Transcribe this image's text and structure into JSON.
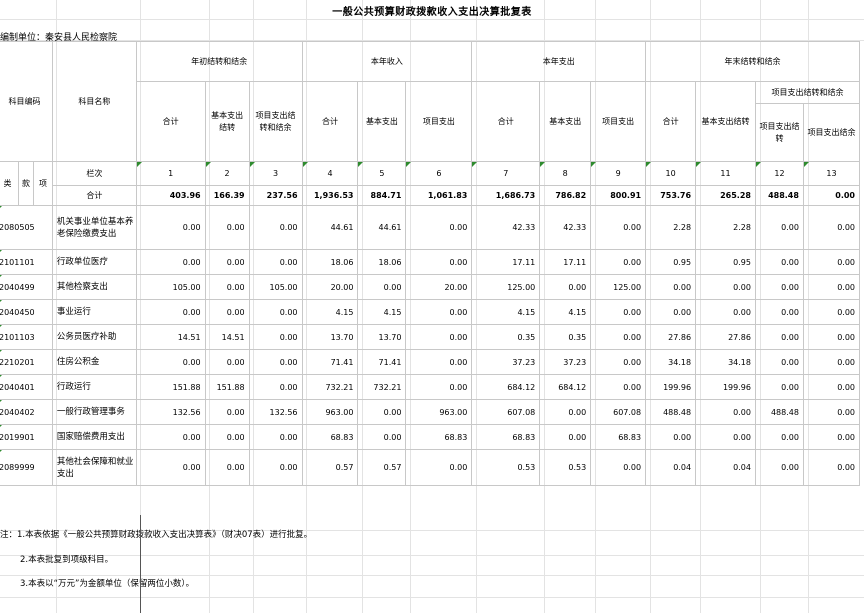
{
  "title": "一般公共预算财政拨款收入支出决算批复表",
  "unit_label": "编制单位：秦安县人民检察院",
  "headers": {
    "code": "科目编码",
    "name": "科目名称",
    "g1": "年初结转和结余",
    "g2": "本年收入",
    "g3": "本年支出",
    "g4": "年末结转和结余",
    "g4sub": "项目支出结转和结余",
    "total": "合计",
    "basic_carry": "基本支出结转",
    "proj_carry": "项目支出结转和结余",
    "basic": "基本支出",
    "proj": "项目支出",
    "proj_c": "项目支出结转",
    "proj_b": "项目支出结余",
    "lei": "类",
    "kuan": "款",
    "xiang": "项",
    "row_index_label": "栏次",
    "sum_label": "合计"
  },
  "col_indexes": [
    "1",
    "2",
    "3",
    "4",
    "5",
    "6",
    "7",
    "8",
    "9",
    "10",
    "11",
    "12",
    "13"
  ],
  "totals": [
    "403.96",
    "166.39",
    "237.56",
    "1,936.53",
    "884.71",
    "1,061.83",
    "1,686.73",
    "786.82",
    "800.91",
    "753.76",
    "265.28",
    "488.48",
    "0.00"
  ],
  "rows": [
    {
      "code": "2080505",
      "name": "机关事业单位基本养老保险缴费支出",
      "vals": [
        "0.00",
        "0.00",
        "0.00",
        "44.61",
        "44.61",
        "0.00",
        "42.33",
        "42.33",
        "0.00",
        "2.28",
        "2.28",
        "0.00",
        "0.00"
      ]
    },
    {
      "code": "2101101",
      "name": "行政单位医疗",
      "vals": [
        "0.00",
        "0.00",
        "0.00",
        "18.06",
        "18.06",
        "0.00",
        "17.11",
        "17.11",
        "0.00",
        "0.95",
        "0.95",
        "0.00",
        "0.00"
      ]
    },
    {
      "code": "2040499",
      "name": "其他检察支出",
      "vals": [
        "105.00",
        "0.00",
        "105.00",
        "20.00",
        "0.00",
        "20.00",
        "125.00",
        "0.00",
        "125.00",
        "0.00",
        "0.00",
        "0.00",
        "0.00"
      ]
    },
    {
      "code": "2040450",
      "name": "事业运行",
      "vals": [
        "0.00",
        "0.00",
        "0.00",
        "4.15",
        "4.15",
        "0.00",
        "4.15",
        "4.15",
        "0.00",
        "0.00",
        "0.00",
        "0.00",
        "0.00"
      ]
    },
    {
      "code": "2101103",
      "name": "公务员医疗补助",
      "vals": [
        "14.51",
        "14.51",
        "0.00",
        "13.70",
        "13.70",
        "0.00",
        "0.35",
        "0.35",
        "0.00",
        "27.86",
        "27.86",
        "0.00",
        "0.00"
      ]
    },
    {
      "code": "2210201",
      "name": "住房公积金",
      "vals": [
        "0.00",
        "0.00",
        "0.00",
        "71.41",
        "71.41",
        "0.00",
        "37.23",
        "37.23",
        "0.00",
        "34.18",
        "34.18",
        "0.00",
        "0.00"
      ]
    },
    {
      "code": "2040401",
      "name": "行政运行",
      "vals": [
        "151.88",
        "151.88",
        "0.00",
        "732.21",
        "732.21",
        "0.00",
        "684.12",
        "684.12",
        "0.00",
        "199.96",
        "199.96",
        "0.00",
        "0.00"
      ]
    },
    {
      "code": "2040402",
      "name": "一般行政管理事务",
      "vals": [
        "132.56",
        "0.00",
        "132.56",
        "963.00",
        "0.00",
        "963.00",
        "607.08",
        "0.00",
        "607.08",
        "488.48",
        "0.00",
        "488.48",
        "0.00"
      ]
    },
    {
      "code": "2019901",
      "name": "国家赔偿费用支出",
      "vals": [
        "0.00",
        "0.00",
        "0.00",
        "68.83",
        "0.00",
        "68.83",
        "68.83",
        "0.00",
        "68.83",
        "0.00",
        "0.00",
        "0.00",
        "0.00"
      ]
    },
    {
      "code": "2089999",
      "name": "其他社会保障和就业支出",
      "vals": [
        "0.00",
        "0.00",
        "0.00",
        "0.57",
        "0.57",
        "0.00",
        "0.53",
        "0.53",
        "0.00",
        "0.04",
        "0.04",
        "0.00",
        "0.00"
      ]
    }
  ],
  "notes": [
    "注：1.本表依据《一般公共预算财政拨款收入支出决算表》（财决07表）进行批复。",
    "2.本表批复到项级科目。",
    "3.本表以“万元”为金额单位（保留两位小数）。"
  ]
}
